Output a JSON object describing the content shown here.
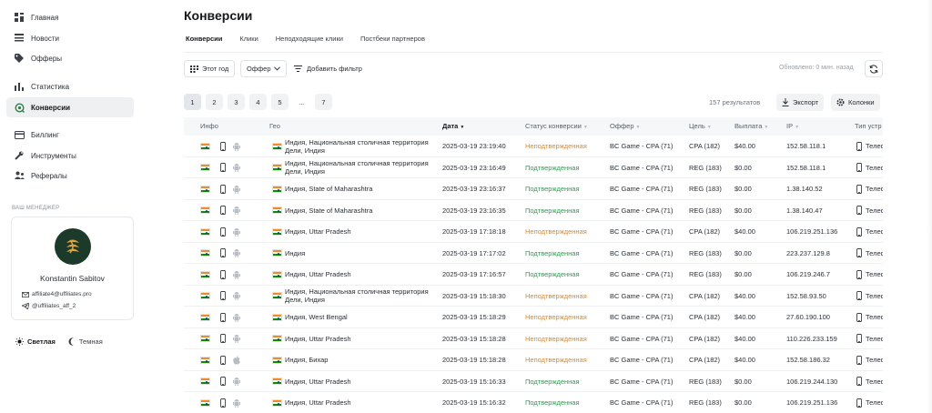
{
  "sidebar": {
    "items": [
      {
        "label": "Главная",
        "icon": "dashboard-icon"
      },
      {
        "label": "Новости",
        "icon": "news-icon"
      },
      {
        "label": "Офферы",
        "icon": "tag-icon"
      },
      {
        "label": "Статистика",
        "icon": "bar-chart-icon"
      },
      {
        "label": "Конверсии",
        "icon": "conversion-icon",
        "active": true
      },
      {
        "label": "Биллинг",
        "icon": "card-icon"
      },
      {
        "label": "Инструменты",
        "icon": "wrench-icon"
      },
      {
        "label": "Рефералы",
        "icon": "referrals-icon"
      }
    ],
    "manager": {
      "section_label": "ВАШ МЕНЕДЖЕР",
      "name": "Konstantin Sabitov",
      "email": "affiliate4@uffiliates.pro",
      "telegram": "@uffiliates_aff_2"
    },
    "theme": {
      "light": "Светлая",
      "dark": "Темная",
      "selected": "light"
    }
  },
  "main": {
    "title": "Конверсии",
    "tabs": [
      {
        "label": "Конверсии",
        "active": true
      },
      {
        "label": "Клики"
      },
      {
        "label": "Неподходящие клики"
      },
      {
        "label": "Постбеки партнеров"
      }
    ],
    "toolbar": {
      "period": "Этот год",
      "offer_select": "Оффер",
      "add_filter": "Добавить фильтр",
      "updated": "Обновлено: 0 мин. назад"
    },
    "pagination": {
      "pages": [
        "1",
        "2",
        "3",
        "4",
        "5"
      ],
      "dots": "...",
      "last": "7",
      "current": "1"
    },
    "results": "157 результатов",
    "export_label": "Экспорт",
    "columns_label": "Колонки",
    "table": {
      "headers": {
        "info": "Инфо",
        "geo": "Гео",
        "date": "Дата",
        "status": "Статус конверсии",
        "offer": "Оффер",
        "goal": "Цель",
        "payout": "Выплата",
        "ip": "IP",
        "device": "Тип устр"
      },
      "rows": [
        {
          "os": "android",
          "geo": "Индия, Национальная столичная территория Дели, Индия",
          "date": "2025-03-19 23:19:40",
          "status": "Неподтвержденная",
          "status_type": "pending",
          "offer": "BC Game - CPA (71)",
          "goal": "CPA (182)",
          "payout": "$40.00",
          "ip": "152.58.118.1",
          "device": "Телеф"
        },
        {
          "os": "android",
          "geo": "Индия, Национальная столичная территория Дели, Индия",
          "date": "2025-03-19 23:16:49",
          "status": "Подтвержденная",
          "status_type": "confirmed",
          "offer": "BC Game - CPA (71)",
          "goal": "REG (183)",
          "payout": "$0.00",
          "ip": "152.58.118.1",
          "device": "Телеф"
        },
        {
          "os": "android",
          "geo": "Индия, State of Maharashtra",
          "date": "2025-03-19 23:16:37",
          "status": "Подтвержденная",
          "status_type": "confirmed",
          "offer": "BC Game - CPA (71)",
          "goal": "REG (183)",
          "payout": "$0.00",
          "ip": "1.38.140.52",
          "device": "Телеф"
        },
        {
          "os": "android",
          "geo": "Индия, State of Maharashtra",
          "date": "2025-03-19 23:16:35",
          "status": "Подтвержденная",
          "status_type": "confirmed",
          "offer": "BC Game - CPA (71)",
          "goal": "REG (183)",
          "payout": "$0.00",
          "ip": "1.38.140.47",
          "device": "Телеф"
        },
        {
          "os": "android",
          "geo": "Индия, Uttar Pradesh",
          "date": "2025-03-19 17:18:18",
          "status": "Неподтвержденная",
          "status_type": "pending",
          "offer": "BC Game - CPA (71)",
          "goal": "CPA (182)",
          "payout": "$40.00",
          "ip": "106.219.251.136",
          "device": "Телеф"
        },
        {
          "os": "android",
          "geo": "Индия",
          "date": "2025-03-19 17:17:02",
          "status": "Подтвержденная",
          "status_type": "confirmed",
          "offer": "BC Game - CPA (71)",
          "goal": "REG (183)",
          "payout": "$0.00",
          "ip": "223.237.129.8",
          "device": "Телеф"
        },
        {
          "os": "android",
          "geo": "Индия, Uttar Pradesh",
          "date": "2025-03-19 17:16:57",
          "status": "Подтвержденная",
          "status_type": "confirmed",
          "offer": "BC Game - CPA (71)",
          "goal": "REG (183)",
          "payout": "$0.00",
          "ip": "106.219.246.7",
          "device": "Телеф"
        },
        {
          "os": "android",
          "geo": "Индия, Национальная столичная территория Дели, Индия",
          "date": "2025-03-19 15:18:30",
          "status": "Неподтвержденная",
          "status_type": "pending",
          "offer": "BC Game - CPA (71)",
          "goal": "CPA (182)",
          "payout": "$40.00",
          "ip": "152.58.93.50",
          "device": "Телеф"
        },
        {
          "os": "android",
          "geo": "Индия, West Bengal",
          "date": "2025-03-19 15:18:29",
          "status": "Неподтвержденная",
          "status_type": "pending",
          "offer": "BC Game - CPA (71)",
          "goal": "CPA (182)",
          "payout": "$40.00",
          "ip": "27.60.190.100",
          "device": "Телеф"
        },
        {
          "os": "android",
          "geo": "Индия, Uttar Pradesh",
          "date": "2025-03-19 15:18:28",
          "status": "Неподтвержденная",
          "status_type": "pending",
          "offer": "BC Game - CPA (71)",
          "goal": "CPA (182)",
          "payout": "$40.00",
          "ip": "110.226.233.159",
          "device": "Телеф"
        },
        {
          "os": "apple",
          "geo": "Индия, Бихар",
          "date": "2025-03-19 15:18:28",
          "status": "Неподтвержденная",
          "status_type": "pending",
          "offer": "BC Game - CPA (71)",
          "goal": "CPA (182)",
          "payout": "$40.00",
          "ip": "152.58.186.32",
          "device": "Телеф"
        },
        {
          "os": "android",
          "geo": "Индия, Uttar Pradesh",
          "date": "2025-03-19 15:16:33",
          "status": "Подтвержденная",
          "status_type": "confirmed",
          "offer": "BC Game - CPA (71)",
          "goal": "REG (183)",
          "payout": "$0.00",
          "ip": "106.219.244.130",
          "device": "Телеф"
        },
        {
          "os": "android",
          "geo": "Индия, Uttar Pradesh",
          "date": "2025-03-19 15:16:32",
          "status": "Подтвержденная",
          "status_type": "confirmed",
          "offer": "BC Game - CPA (71)",
          "goal": "REG (183)",
          "payout": "$0.00",
          "ip": "106.219.251.136",
          "device": "Телеф"
        }
      ]
    }
  },
  "colors": {
    "accent": "#2e7d4a",
    "pending": "#e0872a",
    "confirmed": "#2e9c52"
  }
}
